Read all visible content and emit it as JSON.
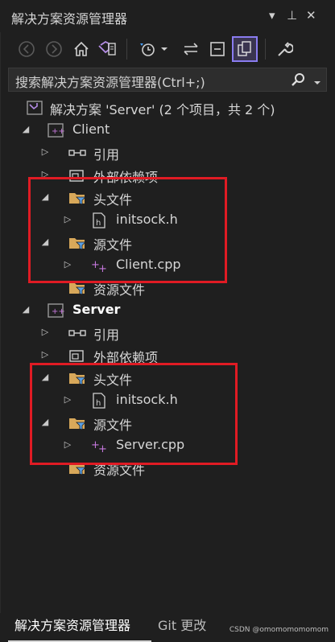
{
  "window": {
    "title": "解决方案资源管理器",
    "controls": {
      "dropdown": "▾",
      "pin": "⊥",
      "close": "✕"
    }
  },
  "toolbar": {
    "icons": [
      "back-icon",
      "forward-icon",
      "home-icon",
      "vs-solution-icon",
      "history-clock-icon",
      "dropdown-arrow-icon",
      "sync-icon",
      "collapse-all-icon",
      "show-all-files-icon",
      "properties-wrench-icon"
    ]
  },
  "search": {
    "placeholder": "搜索解决方案资源管理器(Ctrl+;)"
  },
  "tree": {
    "solution": "解决方案 'Server' (2 个项目，共 2 个)",
    "client": {
      "name": "Client",
      "references": "引用",
      "external_deps": "外部依赖项",
      "headers": "头文件",
      "header_file": "initsock.h",
      "sources": "源文件",
      "source_file": "Client.cpp",
      "resources": "资源文件"
    },
    "server": {
      "name": "Server",
      "references": "引用",
      "external_deps": "外部依赖项",
      "headers": "头文件",
      "header_file": "initsock.h",
      "sources": "源文件",
      "source_file": "Server.cpp",
      "resources": "资源文件"
    }
  },
  "tabs": {
    "active": "解决方案资源管理器",
    "inactive": "Git 更改"
  },
  "watermark": "CSDN @omomomomomom",
  "colors": {
    "background": "#1f1f1f",
    "highlight": "#e01b24",
    "folder": "#d8a85a",
    "filter": "#5aa0e6",
    "cpp": "#c678dd",
    "active_button_border": "#8a7cf0"
  }
}
